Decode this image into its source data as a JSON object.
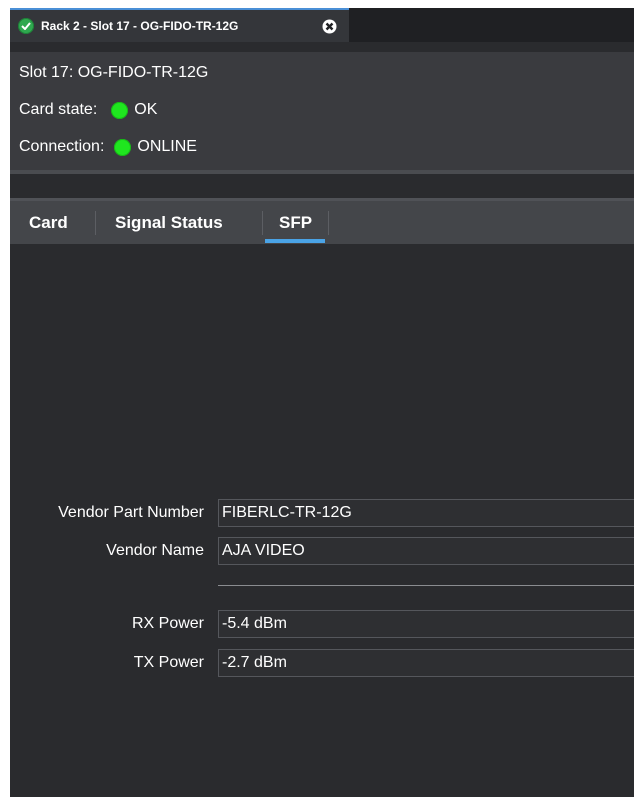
{
  "window": {
    "tab_title": "Rack 2 - Slot 17 - OG-FIDO-TR-12G"
  },
  "info": {
    "slot": "Slot 17: OG-FIDO-TR-12G",
    "card_state_label": "Card state:",
    "card_state_value": "OK",
    "connection_label": "Connection:",
    "connection_value": "ONLINE"
  },
  "tabs": [
    {
      "label": "Card",
      "active": false
    },
    {
      "label": "Signal Status",
      "active": false
    },
    {
      "label": "SFP",
      "active": true
    }
  ],
  "sfp": {
    "vendor_part_number_label": "Vendor Part Number",
    "vendor_part_number_value": "FIBERLC-TR-12G",
    "vendor_name_label": "Vendor Name",
    "vendor_name_value": "AJA VIDEO",
    "rx_power_label": "RX Power",
    "rx_power_value": "-5.4 dBm",
    "tx_power_label": "TX Power",
    "tx_power_value": "-2.7 dBm"
  },
  "colors": {
    "status_green": "#1fe61f",
    "accent_blue": "#4aa3e6"
  }
}
